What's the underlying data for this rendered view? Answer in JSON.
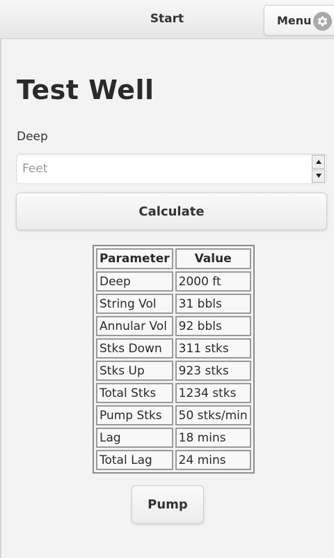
{
  "header": {
    "title": "Start",
    "menu_label": "Menu",
    "menu_icon": "gear-icon"
  },
  "page": {
    "title": "Test Well"
  },
  "depth_field": {
    "label": "Deep",
    "value": "",
    "placeholder": "Feet"
  },
  "buttons": {
    "calculate": "Calculate",
    "pump": "Pump"
  },
  "results_table": {
    "headers": [
      "Parameter",
      "Value"
    ],
    "rows": [
      {
        "parameter": "Deep",
        "value": "2000 ft"
      },
      {
        "parameter": "String Vol",
        "value": "31 bbls"
      },
      {
        "parameter": "Annular Vol",
        "value": "92 bbls"
      },
      {
        "parameter": "Stks Down",
        "value": "311 stks"
      },
      {
        "parameter": "Stks Up",
        "value": "923 stks"
      },
      {
        "parameter": "Total Stks",
        "value": "1234 stks"
      },
      {
        "parameter": "Pump Stks",
        "value": "50 stks/min"
      },
      {
        "parameter": "Lag",
        "value": "18 mins"
      },
      {
        "parameter": "Total Lag",
        "value": "24 mins"
      }
    ]
  }
}
